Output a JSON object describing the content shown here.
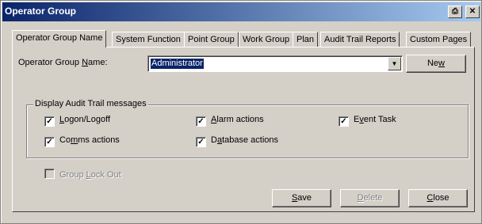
{
  "window": {
    "title": "Operator Group",
    "print_icon": "print-icon",
    "close_glyph": "✕"
  },
  "tabs": [
    {
      "label": "Operator Group Name",
      "active": true
    },
    {
      "label": "System Function"
    },
    {
      "label": "Point Group"
    },
    {
      "label": "Work Group"
    },
    {
      "label": "Plan"
    },
    {
      "label": "Audit Trail Reports"
    },
    {
      "label": "Custom Pages"
    }
  ],
  "form": {
    "name_label_pre": "Operator Group ",
    "name_label_ul": "N",
    "name_label_post": "ame:",
    "name_value": "Administrator",
    "new_pre": "Ne",
    "new_ul": "w",
    "new_post": ""
  },
  "audit": {
    "group_title": "Display Audit Trail messages",
    "logon_pre": "",
    "logon_ul": "L",
    "logon_post": "ogon/Logoff",
    "alarm_pre": "",
    "alarm_ul": "A",
    "alarm_post": "larm actions",
    "event_pre": "E",
    "event_ul": "v",
    "event_post": "ent Task",
    "comms_pre": "Co",
    "comms_ul": "m",
    "comms_post": "ms actions",
    "db_pre": "D",
    "db_ul": "a",
    "db_post": "tabase actions",
    "check": "✓"
  },
  "lockout": {
    "pre": "Group ",
    "ul": "L",
    "post": "ock Out"
  },
  "buttons": {
    "save_ul": "S",
    "save_post": "ave",
    "delete_ul": "D",
    "delete_post": "elete",
    "close_ul": "C",
    "close_post": "lose"
  }
}
